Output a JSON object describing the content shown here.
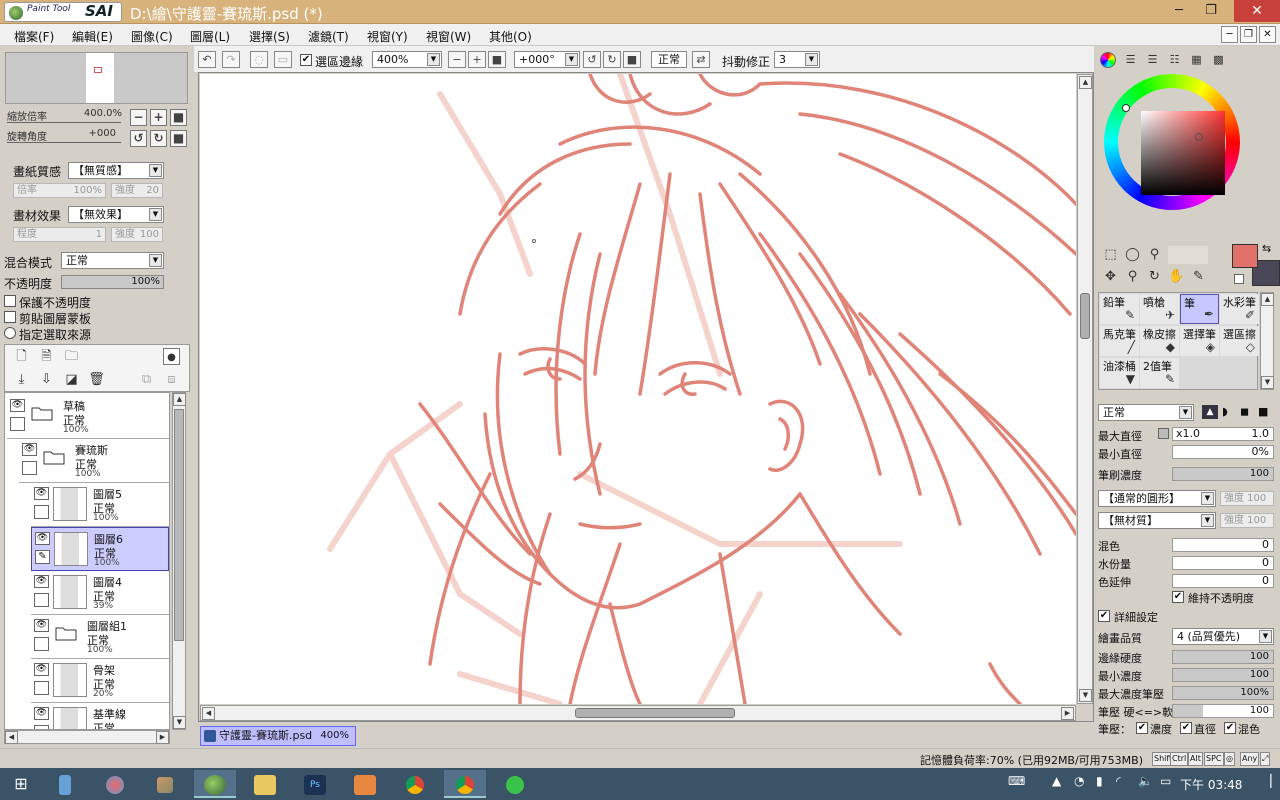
{
  "app": {
    "logo_sub": "Paint Tool",
    "logo_main": "SAI",
    "title": "D:\\繪\\守護靈-賽琉斯.psd (*)"
  },
  "menu": [
    "檔案(F)",
    "編輯(E)",
    "圖像(C)",
    "圖層(L)",
    "選擇(S)",
    "濾鏡(T)",
    "視窗(Y)",
    "視窗(W)",
    "其他(O)"
  ],
  "navigator": {
    "zoom_label": "縮放倍率",
    "zoom_value": "400.0%",
    "angle_label": "旋轉角度",
    "angle_value": "+000"
  },
  "paper": {
    "texture_label": "畫紙質感",
    "texture_value": "【無質感】",
    "rate_label": "倍率",
    "rate_value": "100%",
    "strength_label": "強度",
    "strength_value": "20"
  },
  "material": {
    "label": "畫材效果",
    "value": "【無效果】",
    "degree_label": "程度",
    "degree_value": "1",
    "strength_label": "強度",
    "strength_value": "100"
  },
  "blend": {
    "label": "混合模式",
    "value": "正常",
    "opacity_label": "不透明度",
    "opacity_value": "100%"
  },
  "options": {
    "preserve_opacity": "保護不透明度",
    "clip_group": "剪貼圖層蒙板",
    "selection_source": "指定選取來源"
  },
  "layers": [
    {
      "name": "草稿",
      "mode": "正常",
      "opacity": "100%",
      "type": "folder",
      "indent": 0
    },
    {
      "name": "賽琉斯",
      "mode": "正常",
      "opacity": "100%",
      "type": "folder",
      "indent": 1
    },
    {
      "name": "圖層5",
      "mode": "正常",
      "opacity": "100%",
      "type": "layer",
      "indent": 2
    },
    {
      "name": "圖層6",
      "mode": "正常",
      "opacity": "100%",
      "type": "layer",
      "indent": 2,
      "selected": true
    },
    {
      "name": "圖層4",
      "mode": "正常",
      "opacity": "39%",
      "type": "layer",
      "indent": 2
    },
    {
      "name": "圖層組1",
      "mode": "正常",
      "opacity": "100%",
      "type": "folder",
      "indent": 2
    },
    {
      "name": "骨架",
      "mode": "正常",
      "opacity": "20%",
      "type": "layer",
      "indent": 2
    },
    {
      "name": "基準線",
      "mode": "正常",
      "opacity": "",
      "type": "layer",
      "indent": 2
    }
  ],
  "toolbar": {
    "selection_edge": "選區邊緣",
    "zoom": "400%",
    "rotation": "+000°",
    "mode": "正常",
    "stabilizer_label": "抖動修正",
    "stabilizer_value": "3"
  },
  "brushes": [
    {
      "name": "鉛筆",
      "icon": "✎"
    },
    {
      "name": "噴槍",
      "icon": "✈"
    },
    {
      "name": "筆",
      "icon": "✒",
      "selected": true
    },
    {
      "name": "水彩筆",
      "icon": "✐"
    },
    {
      "name": "馬克筆",
      "icon": "╱"
    },
    {
      "name": "橡皮擦",
      "icon": "◆"
    },
    {
      "name": "選擇筆",
      "icon": "◈"
    },
    {
      "name": "選區擦",
      "icon": "◇"
    },
    {
      "name": "油漆桶",
      "icon": "▼"
    },
    {
      "name": "2值筆",
      "icon": "✎"
    }
  ],
  "brush_settings": {
    "mode": "正常",
    "max_size_label": "最大直徑",
    "max_size_mult": "x1.0",
    "max_size_value": "1.0",
    "min_size_label": "最小直徑",
    "min_size_value": "0%",
    "density_label": "筆刷濃度",
    "density_value": "100",
    "shape": "【通常的圓形】",
    "shape_strength": "強度 100",
    "texture": "【無材質】",
    "texture_strength": "強度 100",
    "mix_label": "混色",
    "mix_value": "0",
    "water_label": "水份量",
    "water_value": "0",
    "extend_label": "色延伸",
    "extend_value": "0",
    "keep_opacity": "維持不透明度",
    "detail_label": "詳細設定",
    "quality_label": "繪畫品質",
    "quality_value": "4 (品質優先)",
    "edge_label": "邊緣硬度",
    "edge_value": "100",
    "min_density_label": "最小濃度",
    "min_density_value": "100",
    "max_pressure_label": "最大濃度筆壓",
    "max_pressure_value": "100%",
    "pressure_label": "筆壓 硬<=>軟",
    "pressure_value": "100",
    "pressure_row": "筆壓：",
    "p_density": "濃度",
    "p_size": "直徑",
    "p_mix": "混色"
  },
  "colors": {
    "foreground": "#e0726a",
    "background": "#4a4858",
    "sketch": "#e08478"
  },
  "document_tab": {
    "name": "守護靈-賽琉斯.psd",
    "zoom": "400%"
  },
  "status": {
    "memory": "記憶體負荷率:70% (已用92MB/可用753MB)",
    "keys": [
      "Shift",
      "Ctrl",
      "Alt",
      "SPC",
      "◎",
      "Any",
      "⤢"
    ]
  },
  "taskbar": {
    "time": "下午 03:48"
  }
}
